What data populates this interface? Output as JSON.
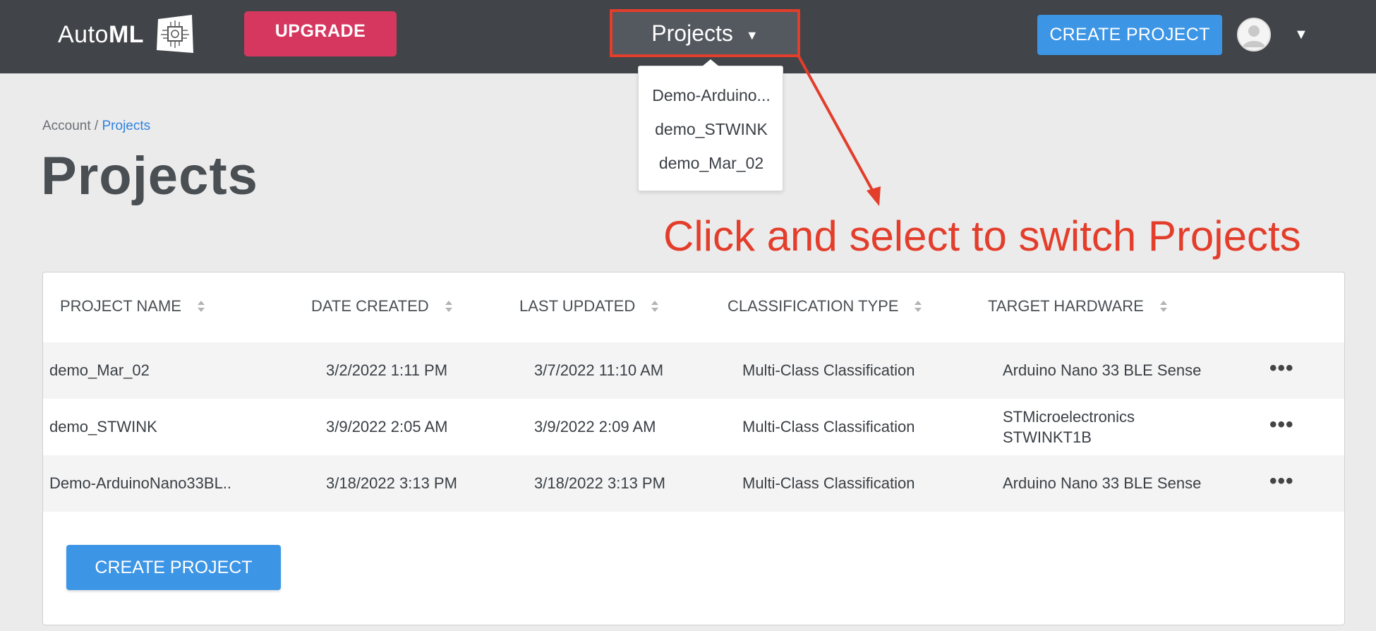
{
  "header": {
    "logo_text_light": "Auto",
    "logo_text_bold": "ML",
    "upgrade_label": "UPGRADE",
    "project_switch_label": "Projects",
    "create_project_label": "CREATE PROJECT"
  },
  "project_dropdown": {
    "items": [
      "Demo-Arduino...",
      "demo_STWINK",
      "demo_Mar_02"
    ]
  },
  "breadcrumb": {
    "account": "Account",
    "separator": " / ",
    "current": "Projects"
  },
  "page_title": "Projects",
  "annotation": {
    "text": "Click and select to switch Projects",
    "color": "#e33d2b"
  },
  "table": {
    "columns": [
      "PROJECT NAME",
      "DATE CREATED",
      "LAST UPDATED",
      "CLASSIFICATION TYPE",
      "TARGET HARDWARE"
    ],
    "rows": [
      {
        "name": "demo_Mar_02",
        "created": "3/2/2022 1:11 PM",
        "updated": "3/7/2022 11:10 AM",
        "classification": "Multi-Class Classification",
        "hardware": "Arduino Nano 33 BLE Sense",
        "more": "•••"
      },
      {
        "name": "demo_STWINK",
        "created": "3/9/2022 2:05 AM",
        "updated": "3/9/2022 2:09 AM",
        "classification": "Multi-Class Classification",
        "hardware": "STMicroelectronics STWINKT1B",
        "more": "•••"
      },
      {
        "name": "Demo-ArduinoNano33BL..",
        "created": "3/18/2022 3:13 PM",
        "updated": "3/18/2022 3:13 PM",
        "classification": "Multi-Class Classification",
        "hardware": "Arduino Nano 33 BLE Sense",
        "more": "•••"
      }
    ]
  },
  "footer": {
    "create_project_label": "CREATE PROJECT"
  },
  "colors": {
    "topbar": "#414448",
    "upgrade": "#d6375f",
    "primary": "#3d95e6",
    "highlight": "#e33d2b",
    "link": "#2f83e0"
  },
  "icons": {
    "logo": "chip-logo-icon",
    "switch_caret": "caret-down-icon",
    "avatar": "user-avatar-icon",
    "sort": "sort-icon",
    "row_menu": "more-horizontal-icon"
  }
}
